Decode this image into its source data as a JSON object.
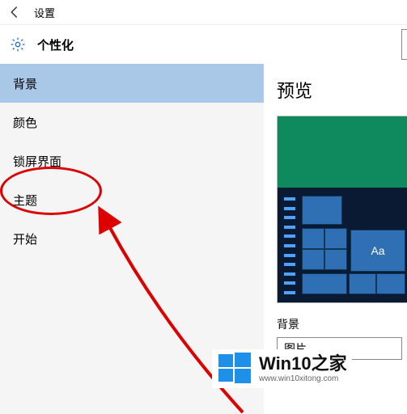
{
  "titlebar": {
    "app_name": "设置"
  },
  "header": {
    "section": "个性化"
  },
  "sidebar": {
    "items": [
      {
        "label": "背景",
        "selected": true
      },
      {
        "label": "颜色",
        "selected": false
      },
      {
        "label": "锁屏界面",
        "selected": false
      },
      {
        "label": "主题",
        "selected": false
      },
      {
        "label": "开始",
        "selected": false
      }
    ]
  },
  "content": {
    "preview_heading": "预览",
    "sample_text": "Aa",
    "bg_label": "背景",
    "bg_value": "图片"
  },
  "watermark": {
    "title": "Win10之家",
    "subtitle": "www.win10xitong.com"
  }
}
